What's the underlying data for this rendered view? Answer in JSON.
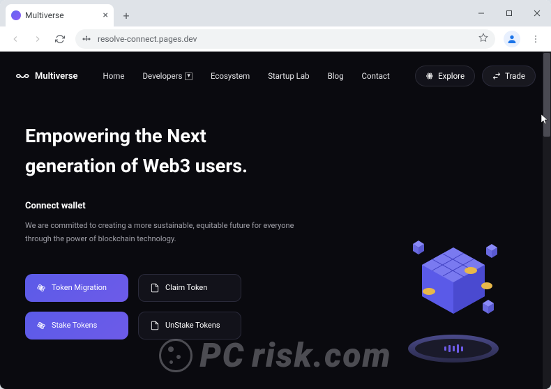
{
  "browser": {
    "tab_title": "Multiverse",
    "url": "resolve-connect.pages.dev"
  },
  "logo": {
    "text": "Multiverse"
  },
  "nav": {
    "home": "Home",
    "developers": "Developers",
    "ecosystem": "Ecosystem",
    "startup_lab": "Startup Lab",
    "blog": "Blog",
    "contact": "Contact"
  },
  "actions": {
    "explore": "Explore",
    "trade": "Trade"
  },
  "hero": {
    "title_line1": "Empowering the Next",
    "title_line2": "generation of Web3 users.",
    "subheading": "Connect wallet",
    "body": "We are committed to creating a more sustainable, equitable future for everyone through the power of blockchain technology."
  },
  "cta": {
    "token_migration": "Token Migration",
    "claim_token": "Claim Token",
    "stake_tokens": "Stake Tokens",
    "unstake_tokens": "UnStake Tokens"
  },
  "watermark": {
    "text1": "PC",
    "text2": "risk.com"
  }
}
